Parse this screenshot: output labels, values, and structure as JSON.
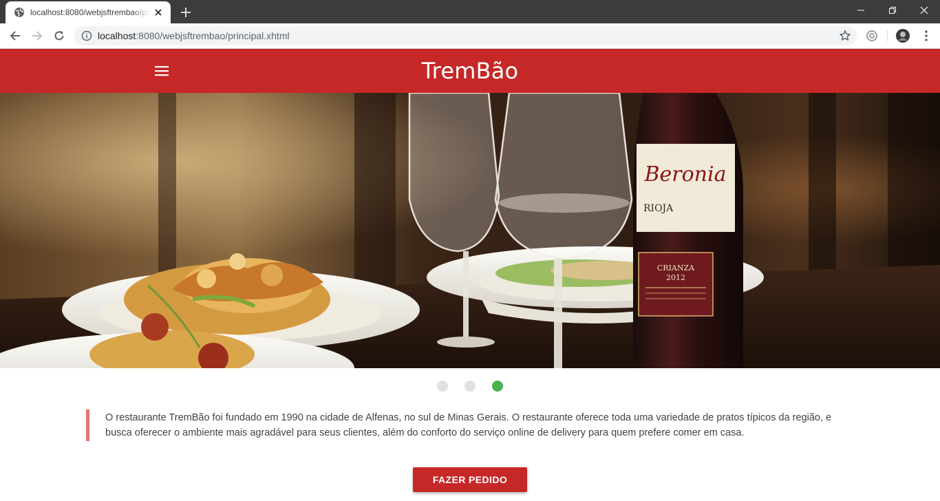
{
  "browser": {
    "tab_title": "localhost:8080/webjsftrembao/principal.xhtml",
    "url_host": "localhost",
    "url_rest": ":8080/webjsftrembao/principal.xhtml"
  },
  "header": {
    "title": "TremBão",
    "menu_icon": "hamburger-menu-icon",
    "background_color": "#c62828"
  },
  "carousel": {
    "slide_count": 3,
    "active_index": 2,
    "active_color": "#4caf50",
    "inactive_color": "#e0e0e0",
    "image_subject": "plates of food, wine glasses and a bottle labeled Beronia Rioja Crianza 2012"
  },
  "about": {
    "text": "O restaurante TremBão foi fundado em 1990 na cidade de Alfenas, no sul de Minas Gerais. O restaurante oferece toda uma variedade de pratos típicos da região, e busca oferecer o ambiente mais agradável para seus clientes, além do conforto do serviço online de delivery para quem prefere comer em casa."
  },
  "cta": {
    "label": "FAZER PEDIDO"
  },
  "wine_label": {
    "brand": "Beronia",
    "region": "RIOJA",
    "style": "CRIANZA",
    "year": "2012"
  }
}
